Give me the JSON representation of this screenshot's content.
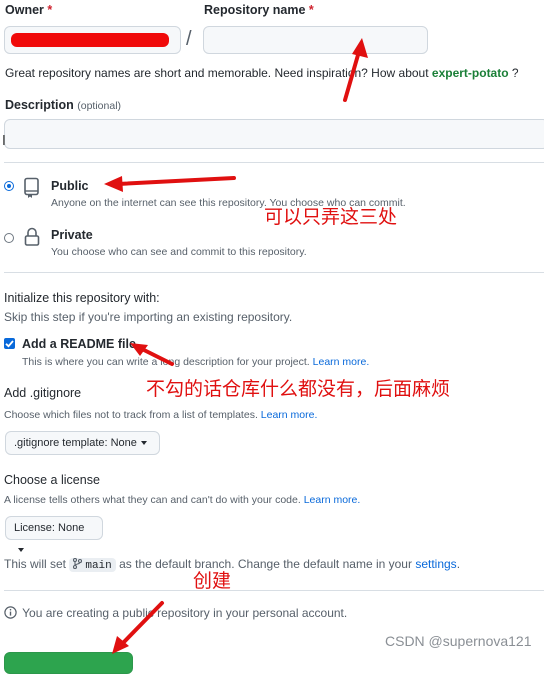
{
  "owner": {
    "label": "Owner",
    "required_mark": "*"
  },
  "repo": {
    "label": "Repository name",
    "required_mark": "*",
    "separator": "/",
    "value": ""
  },
  "hint": {
    "text": "Great repository names are short and memorable. Need inspiration? How about ",
    "suggestion": "expert-potato",
    "end": " ?"
  },
  "description": {
    "label": "Description",
    "optional": "(optional)",
    "value": ""
  },
  "visibility": {
    "public": {
      "label": "Public",
      "desc": "Anyone on the internet can see this repository. You choose who can commit."
    },
    "private": {
      "label": "Private",
      "desc": "You choose who can see and commit to this repository."
    }
  },
  "init": {
    "heading": "Initialize this repository with:",
    "sub": "Skip this step if you're importing an existing repository.",
    "readme_label": "Add a README file",
    "readme_desc": "This is where you can write a long description for your project.",
    "learn_more": "Learn more."
  },
  "gitignore": {
    "heading": "Add .gitignore",
    "desc": "Choose which files not to track from a list of templates.",
    "learn_more": "Learn more.",
    "button": ".gitignore template: None"
  },
  "license": {
    "heading": "Choose a license",
    "desc": "A license tells others what they can and can't do with your code.",
    "learn_more": "Learn more.",
    "button": "License: None"
  },
  "branch": {
    "prefix": "This will set",
    "name": "main",
    "middle": "as the default branch. Change the default name in your",
    "link": "settings",
    "end": "."
  },
  "notice": {
    "text": "You are creating a public repository in your personal account."
  },
  "annotations": {
    "visibility_note": "可以只弄这三处",
    "readme_note": "不勾的话仓库什么都没有，后面麻烦",
    "create_note": "创建"
  },
  "watermark": "CSDN @supernova121",
  "colors": {
    "annotation": "#e01010",
    "accent": "#0969da",
    "create_button": "#2da44e"
  }
}
